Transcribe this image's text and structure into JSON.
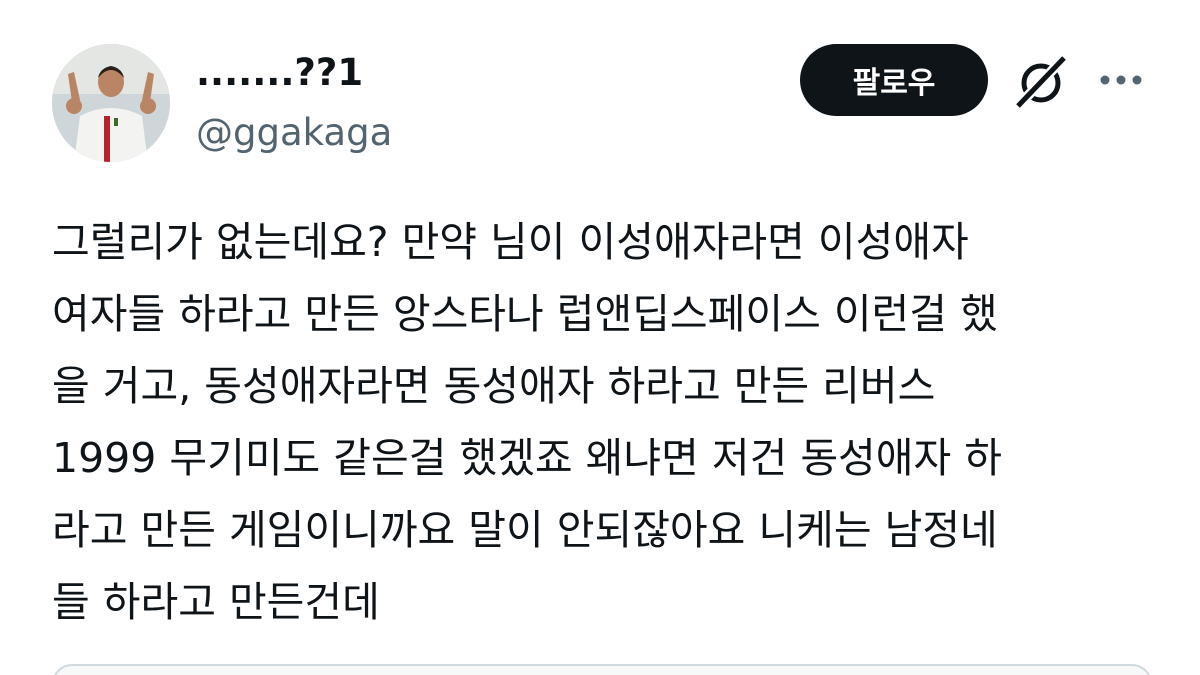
{
  "author": {
    "display_name": ".......??1",
    "handle": "@ggakaga"
  },
  "actions": {
    "follow_label": "팔로우",
    "grok_icon": "grok-icon",
    "more_icon": "more-icon"
  },
  "tweet": {
    "lines": [
      "그럴리가 없는데요? 만약 님이 이성애자라면 이성애자",
      "여자들 하라고 만든 앙스타나 럽앤딥스페이스 이런걸 했",
      "을 거고, 동성애자라면 동성애자 하라고 만든 리버스",
      "1999 무기미도 같은걸 했겠죠 왜냐면 저건 동성애자 하",
      "라고 만든 게임이니까요 말이 안되잖아요 니케는 남정네",
      "들 하라고 만든건데"
    ]
  },
  "colors": {
    "text": "#0f1419",
    "secondary": "#536471",
    "follow_bg": "#0f1419",
    "follow_text": "#ffffff"
  }
}
